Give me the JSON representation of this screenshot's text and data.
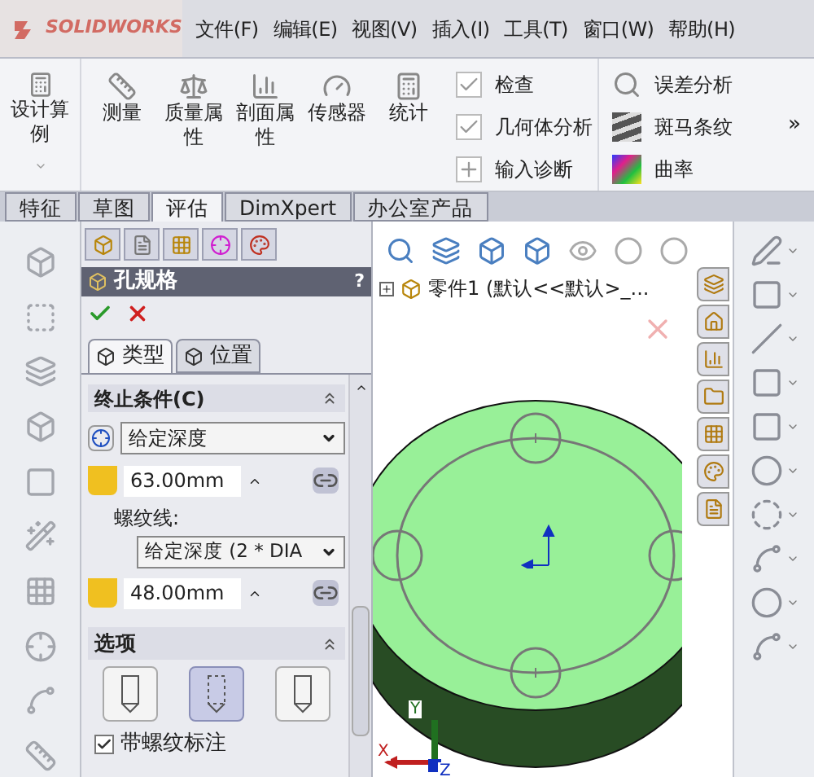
{
  "app": {
    "logo": "SOLIDWORKS"
  },
  "menu": [
    {
      "label": "文件(F)"
    },
    {
      "label": "编辑(E)"
    },
    {
      "label": "视图(V)"
    },
    {
      "label": "插入(I)"
    },
    {
      "label": "工具(T)"
    },
    {
      "label": "窗口(W)"
    },
    {
      "label": "帮助(H)"
    }
  ],
  "ribbon": {
    "design_study": "设计算例",
    "tools": [
      {
        "label": "测量"
      },
      {
        "label": "质量属性"
      },
      {
        "label": "剖面属性"
      },
      {
        "label": "传感器"
      },
      {
        "label": "统计"
      }
    ],
    "checks": [
      {
        "label": "检查"
      },
      {
        "label": "几何体分析"
      },
      {
        "label": "输入诊断"
      }
    ],
    "analysis": [
      {
        "label": "误差分析"
      },
      {
        "label": "斑马条纹"
      },
      {
        "label": "曲率"
      }
    ],
    "more": "»"
  },
  "tabs": [
    {
      "label": "特征",
      "selected": false
    },
    {
      "label": "草图",
      "selected": false
    },
    {
      "label": "评估",
      "selected": true
    },
    {
      "label": "DimXpert",
      "selected": false
    },
    {
      "label": "办公室产品",
      "selected": false
    }
  ],
  "property_manager": {
    "title": "孔规格",
    "help": "?",
    "panel_tabs": [
      {
        "label": "类型",
        "selected": true
      },
      {
        "label": "位置",
        "selected": false
      }
    ],
    "end_condition": {
      "title": "终止条件(C)",
      "type": "给定深度",
      "depth": "63.00mm",
      "thread_label": "螺纹线:",
      "thread_type": "给定深度 (2 * DIA",
      "thread_depth": "48.00mm"
    },
    "options": {
      "title": "选项",
      "buttons": [
        {
          "selected": false
        },
        {
          "selected": true
        },
        {
          "selected": false
        }
      ],
      "thread_callout": {
        "label": "带螺纹标注",
        "checked": true
      }
    }
  },
  "viewport": {
    "tree_item": "零件1 (默认<<默认>_...",
    "axes": [
      "X",
      "Y",
      "Z"
    ]
  }
}
